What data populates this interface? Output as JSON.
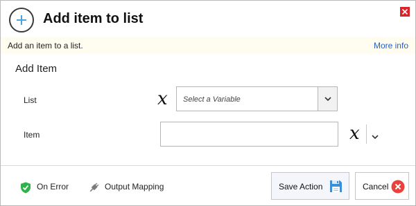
{
  "dialog": {
    "title": "Add item to list",
    "description": "Add an item to a list.",
    "more_info": "More info",
    "section_title": "Add Item"
  },
  "fields": {
    "list_label": "List",
    "list_placeholder": "Select a Variable",
    "item_label": "Item",
    "item_value": ""
  },
  "footer": {
    "on_error": "On Error",
    "output_mapping": "Output Mapping",
    "save_action": "Save Action",
    "cancel": "Cancel"
  },
  "icons": {
    "header": "add-circle-icon",
    "close": "close-icon",
    "variable": "variable-x-icon",
    "dropdown": "chevron-down-icon",
    "on_error": "shield-check-icon",
    "output_mapping": "plug-icon",
    "save": "floppy-disk-icon",
    "cancel": "cancel-circle-icon"
  },
  "colors": {
    "link": "#2460c4",
    "info_bar_bg": "#fffdf0",
    "close_red": "#d6262c",
    "shield_green": "#2fb24c",
    "cancel_red": "#e8423c",
    "header_icon_plus": "#4aa3df"
  }
}
